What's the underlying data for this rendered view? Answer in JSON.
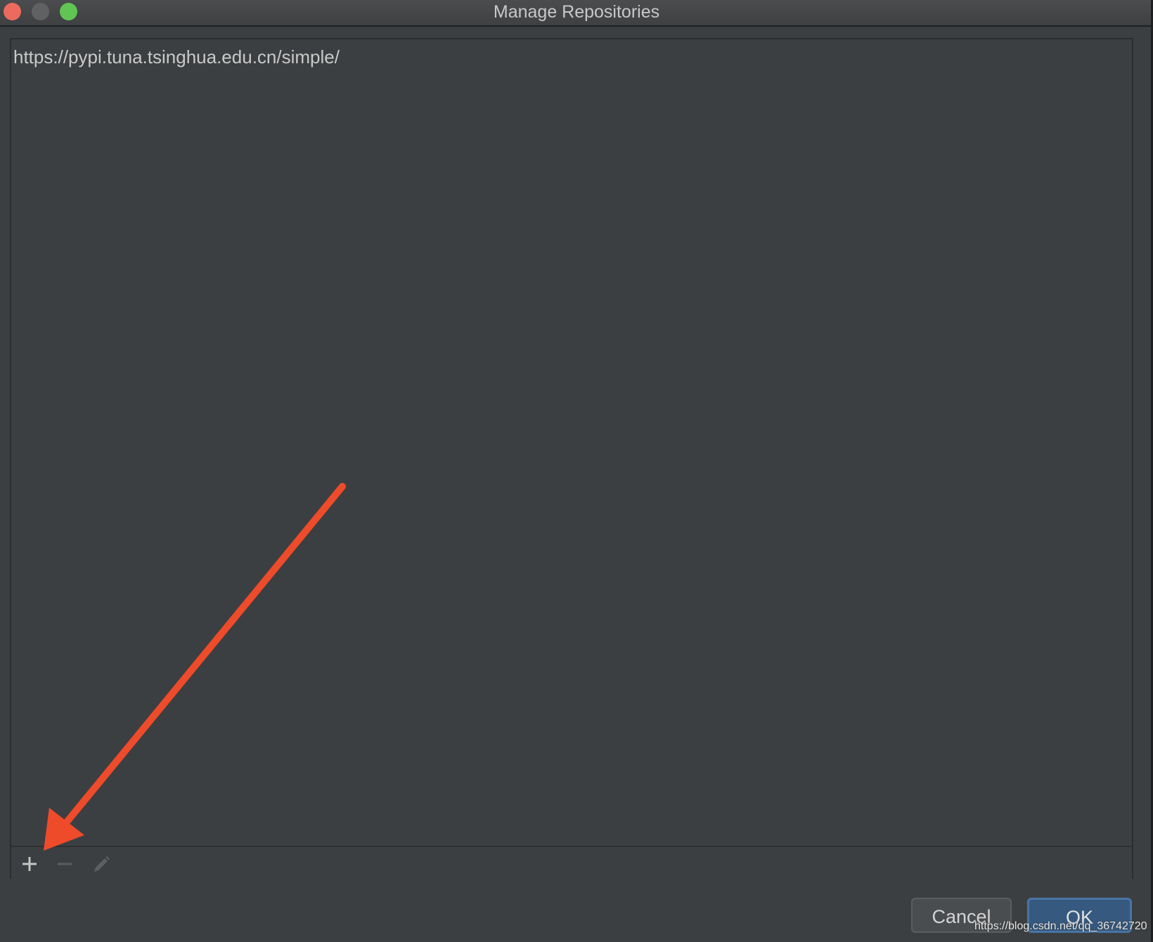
{
  "window": {
    "title": "Manage Repositories"
  },
  "repositories": [
    "https://pypi.tuna.tsinghua.edu.cn/simple/"
  ],
  "toolbar": {
    "add_icon": "plus-icon",
    "remove_icon": "minus-icon",
    "edit_icon": "pencil-icon"
  },
  "buttons": {
    "cancel_label": "Cancel",
    "ok_label": "OK"
  },
  "watermark": "https://blog.csdn.net/qq_36742720",
  "colors": {
    "background": "#3c3f41",
    "annotation_arrow": "#ee4b2b",
    "ok_button": "#36597f"
  }
}
